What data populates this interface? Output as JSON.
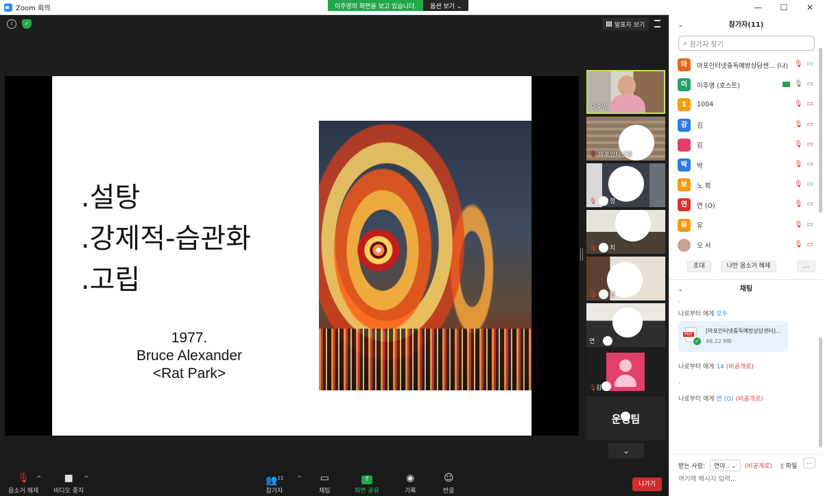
{
  "window": {
    "title": "Zoom 회의"
  },
  "banner": {
    "message": "이주영의 화면을 보고 있습니다.",
    "options": "옵션 보기 ⌄"
  },
  "window_controls": {
    "minimize": "—",
    "maximize": "☐",
    "close": "✕"
  },
  "view": {
    "speaker_view": "발표자 보기"
  },
  "slide": {
    "bullets": [
      ".설탕",
      ".강제적-습관화",
      ".고립"
    ],
    "caption_lines": [
      "1977.",
      "Bruce Alexander",
      "<Rat Park>"
    ]
  },
  "thumbnails": [
    {
      "name": "이주영"
    },
    {
      "name": "마포인터넷중"
    },
    {
      "name": "정"
    },
    {
      "name": "치"
    },
    {
      "name": "정"
    },
    {
      "name": "연"
    },
    {
      "name": "김"
    },
    {
      "name": "운영팀"
    }
  ],
  "toolbar": {
    "mute": "음소거 해제",
    "video": "비디오 중지",
    "participants": "참가자",
    "participants_count": "11",
    "chat": "채팅",
    "share": "화면 공유",
    "record": "기록",
    "reactions": "반응",
    "leave": "나가기"
  },
  "participants_panel": {
    "title": "참가자(11)",
    "search_placeholder": "참가자 찾기",
    "participants": [
      {
        "initial": "마",
        "name": "마포인터넷중독예방상담센... (나)",
        "color": "#e36a1e"
      },
      {
        "initial": "이",
        "name": "이주영 (호스트)",
        "color": "#24a06b"
      },
      {
        "initial": "1",
        "name": "1004",
        "color": "#f29c12"
      },
      {
        "initial": "강",
        "name": "김",
        "color": "#2d7be0"
      },
      {
        "initial": "",
        "name": "김",
        "color": "#e0406a"
      },
      {
        "initial": "박",
        "name": "박",
        "color": "#2d7be0"
      },
      {
        "initial": "보",
        "name": "노    희",
        "color": "#f29c12"
      },
      {
        "initial": "연",
        "name": "연       (O)",
        "color": "#d9322e"
      },
      {
        "initial": "유",
        "name": "유",
        "color": "#f29c12"
      },
      {
        "initial": "",
        "name": "오    서",
        "color": "#c9a090"
      }
    ],
    "invite": "초대",
    "unmute_me": "나만 음소거 해제",
    "more": "..."
  },
  "chat_panel": {
    "title": "채팅",
    "messages": [
      {
        "from": "나로부터 에게",
        "to": "모두",
        "private": ""
      },
      {
        "from": "나로부터 에게",
        "to": "14",
        "private": "(비공개로)"
      },
      {
        "from": "나로부터 에게",
        "to": "연    (O)",
        "private": "(비공개로)"
      }
    ],
    "file": {
      "name": "[마포인터넷중독예방상담센터]...",
      "size": "46.22 MB"
    },
    "to_label": "받는 사람:",
    "to_value": "연아.. ⌄",
    "to_private": "(비공개로)",
    "file_button": "파일",
    "more": "...",
    "input_placeholder": "여기에 메시지 입력..."
  }
}
